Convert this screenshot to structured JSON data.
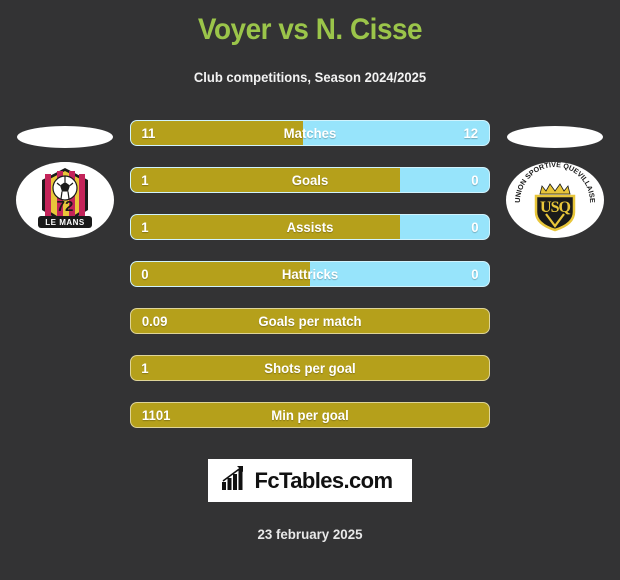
{
  "header": {
    "title": "Voyer vs N. Cisse",
    "subtitle": "Club competitions, Season 2024/2025"
  },
  "colors": {
    "background": "#333334",
    "title_green": "#9BC54A",
    "home_gold": "#B5A01B",
    "away_blue": "#97E4FB",
    "text_white": "#FFFFFF"
  },
  "teams": {
    "home": {
      "logo_name": "le-mans-fc-logo",
      "crest_text": "LE MANS",
      "crest_number": "72"
    },
    "away": {
      "logo_name": "union-sportive-quevillaise-logo",
      "crest_text": "UNION SPORTIVE QUEVILLAISE",
      "crest_monogram": "USQ"
    }
  },
  "stats": [
    {
      "label": "Matches",
      "home": "11",
      "away": "12",
      "home_pct": 48,
      "dual": true
    },
    {
      "label": "Goals",
      "home": "1",
      "away": "0",
      "home_pct": 75,
      "dual": true
    },
    {
      "label": "Assists",
      "home": "1",
      "away": "0",
      "home_pct": 75,
      "dual": true
    },
    {
      "label": "Hattricks",
      "home": "0",
      "away": "0",
      "home_pct": 50,
      "dual": true
    },
    {
      "label": "Goals per match",
      "home": "0.09",
      "away": "",
      "home_pct": 100,
      "dual": false
    },
    {
      "label": "Shots per goal",
      "home": "1",
      "away": "",
      "home_pct": 100,
      "dual": false
    },
    {
      "label": "Min per goal",
      "home": "1101",
      "away": "",
      "home_pct": 100,
      "dual": false
    }
  ],
  "footer": {
    "brand": "FcTables.com",
    "brand_icon": "bar-chart-icon",
    "date": "23 february 2025"
  }
}
